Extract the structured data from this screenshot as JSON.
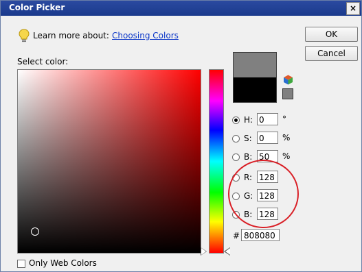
{
  "window": {
    "title": "Color Picker",
    "close_glyph": "×"
  },
  "learn": {
    "label": "Learn more about:",
    "link": "Choosing Colors",
    "icon": "lightbulb-icon"
  },
  "buttons": {
    "ok": "OK",
    "cancel": "Cancel"
  },
  "select_label": "Select color:",
  "swatches": {
    "new_color": "#808080",
    "current_color": "#000000",
    "websafe_color": "#808080"
  },
  "hsb": {
    "h": {
      "label": "H:",
      "value": "0",
      "unit": "°",
      "selected": true
    },
    "s": {
      "label": "S:",
      "value": "0",
      "unit": "%",
      "selected": false
    },
    "b": {
      "label": "B:",
      "value": "50",
      "unit": "%",
      "selected": false
    }
  },
  "rgb": {
    "r": {
      "label": "R:",
      "value": "128",
      "selected": false
    },
    "g": {
      "label": "G:",
      "value": "128",
      "selected": false
    },
    "b": {
      "label": "B:",
      "value": "128",
      "selected": false
    }
  },
  "hex": {
    "label": "#",
    "value": "808080"
  },
  "web_colors": {
    "label": "Only Web Colors",
    "checked": false
  },
  "colors": {
    "highlight": "#d91f26",
    "link": "#0a36c8",
    "titlebar": "#1a3a8c"
  }
}
